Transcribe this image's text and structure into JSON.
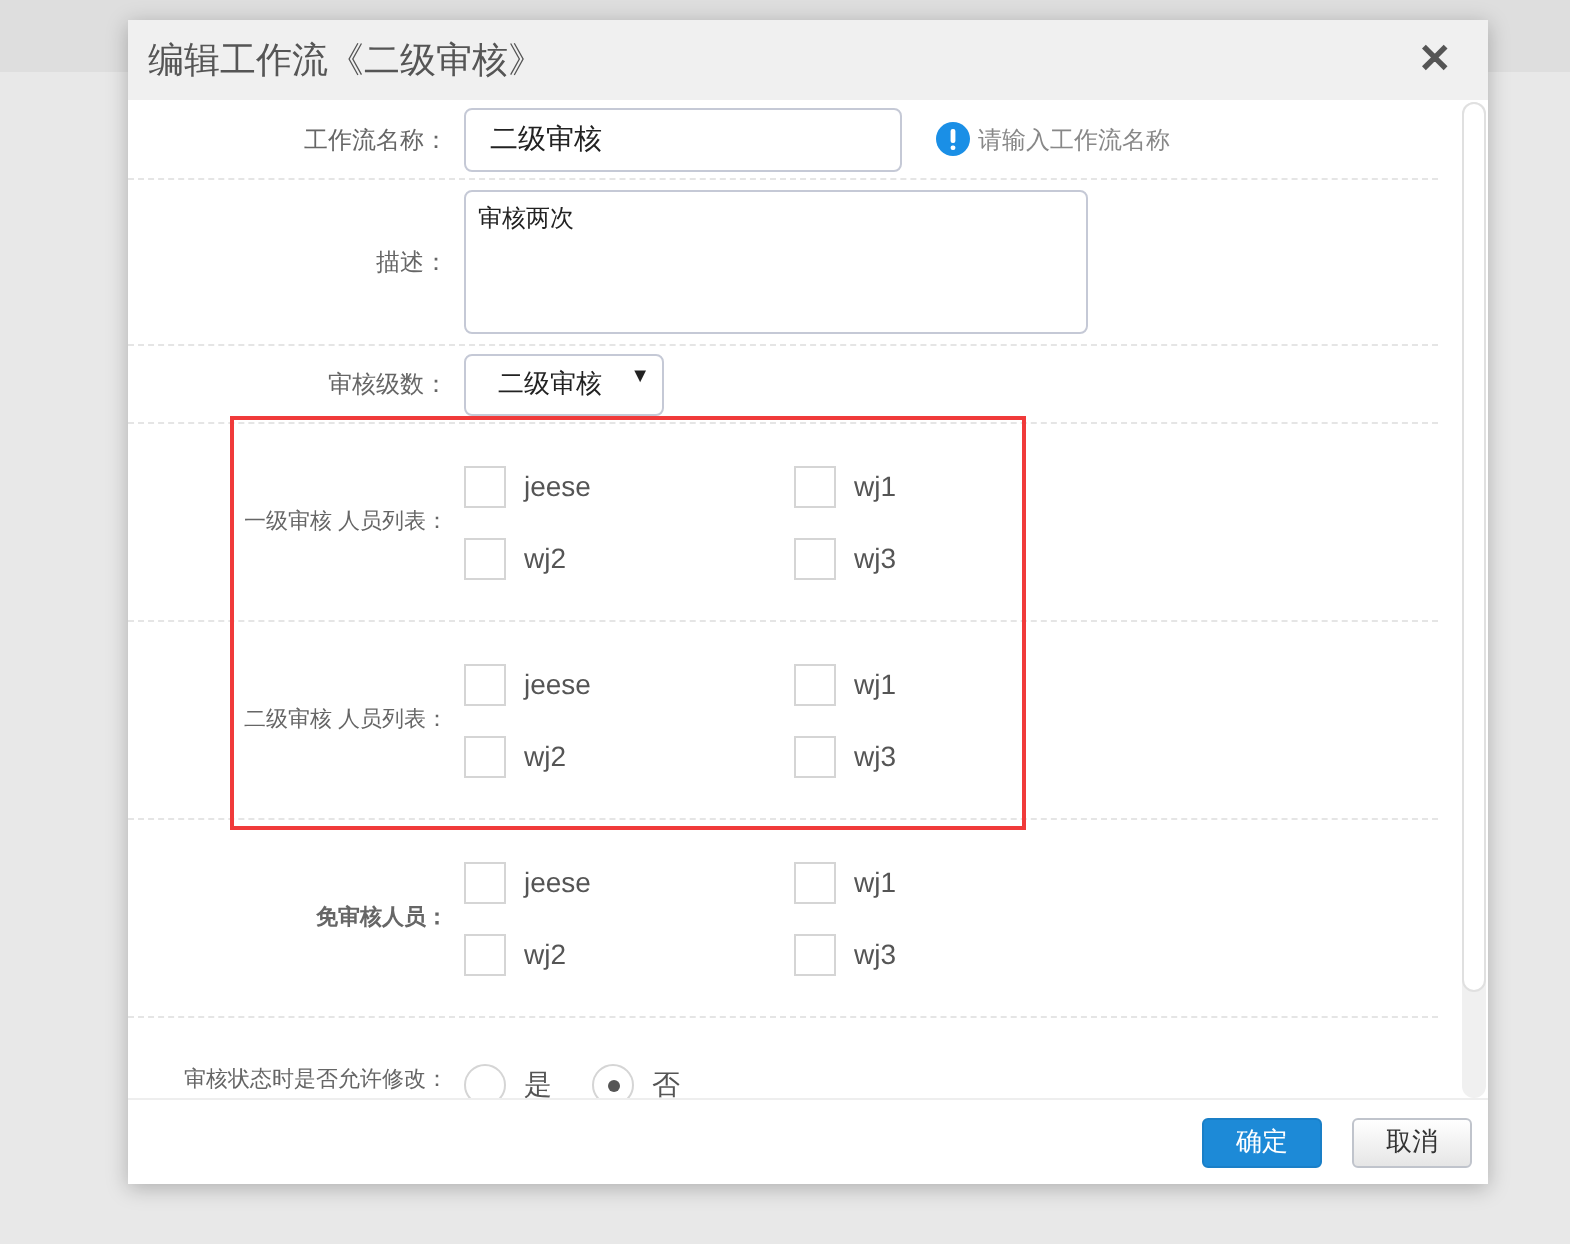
{
  "dialog": {
    "title": "编辑工作流《二级审核》",
    "close": "✕"
  },
  "fields": [
    {
      "kind": "text",
      "label": "工作流名称：",
      "value": "二级审核",
      "hint": "请输入工作流名称"
    },
    {
      "kind": "textarea",
      "label": "描述：",
      "value": "审核两次"
    },
    {
      "kind": "select",
      "label": "审核级数：",
      "value": "二级审核",
      "arrow": "▼"
    },
    {
      "kind": "checks",
      "label": "一级审核 人员列表：",
      "bold": false,
      "options": [
        {
          "label": "jeese",
          "checked": false
        },
        {
          "label": "wj1",
          "checked": false
        },
        {
          "label": "wj2",
          "checked": false
        },
        {
          "label": "wj3",
          "checked": false
        }
      ]
    },
    {
      "kind": "checks",
      "label": "二级审核 人员列表：",
      "bold": false,
      "options": [
        {
          "label": "jeese",
          "checked": false
        },
        {
          "label": "wj1",
          "checked": false
        },
        {
          "label": "wj2",
          "checked": false
        },
        {
          "label": "wj3",
          "checked": false
        }
      ]
    },
    {
      "kind": "checks",
      "label": "免审核人员：",
      "bold": true,
      "options": [
        {
          "label": "jeese",
          "checked": false
        },
        {
          "label": "wj1",
          "checked": false
        },
        {
          "label": "wj2",
          "checked": false
        },
        {
          "label": "wj3",
          "checked": false
        }
      ]
    },
    {
      "kind": "radios",
      "label": "审核状态时是否允许修改：",
      "options": [
        {
          "label": "是",
          "selected": false
        },
        {
          "label": "否",
          "selected": true
        }
      ]
    }
  ],
  "buttons": [
    {
      "label": "确定",
      "primary": true
    },
    {
      "label": "取消",
      "primary": false
    }
  ]
}
